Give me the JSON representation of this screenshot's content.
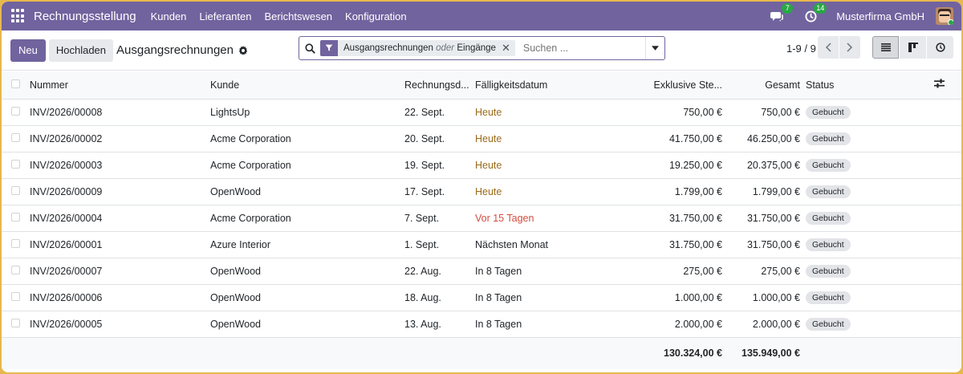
{
  "navbar": {
    "brand": "Rechnungsstellung",
    "menu": [
      "Kunden",
      "Lieferanten",
      "Berichtswesen",
      "Konfiguration"
    ],
    "messages_count": "7",
    "activities_count": "14",
    "company": "Musterfirma GmbH",
    "color": "#71639e"
  },
  "control": {
    "new_label": "Neu",
    "upload_label": "Hochladen",
    "title": "Ausgangsrechnungen",
    "search": {
      "facet_part1": "Ausgangsrechnungen",
      "facet_or": "oder",
      "facet_part2": "Eingänge",
      "placeholder": "Suchen ..."
    },
    "pager": "1-9 / 9"
  },
  "table": {
    "headers": {
      "number": "Nummer",
      "customer": "Kunde",
      "invoice_date": "Rechnungsd...",
      "due_date": "Fälligkeitsdatum",
      "excl_tax": "Exklusive Ste...",
      "total": "Gesamt",
      "status": "Status"
    },
    "rows": [
      {
        "number": "INV/2026/00008",
        "customer": "LightsUp",
        "date": "22. Sept.",
        "due": "Heute",
        "due_state": "today",
        "excl": "750,00 €",
        "total": "750,00 €",
        "status": "Gebucht"
      },
      {
        "number": "INV/2026/00002",
        "customer": "Acme Corporation",
        "date": "20. Sept.",
        "due": "Heute",
        "due_state": "today",
        "excl": "41.750,00 €",
        "total": "46.250,00 €",
        "status": "Gebucht"
      },
      {
        "number": "INV/2026/00003",
        "customer": "Acme Corporation",
        "date": "19. Sept.",
        "due": "Heute",
        "due_state": "today",
        "excl": "19.250,00 €",
        "total": "20.375,00 €",
        "status": "Gebucht"
      },
      {
        "number": "INV/2026/00009",
        "customer": "OpenWood",
        "date": "17. Sept.",
        "due": "Heute",
        "due_state": "today",
        "excl": "1.799,00 €",
        "total": "1.799,00 €",
        "status": "Gebucht"
      },
      {
        "number": "INV/2026/00004",
        "customer": "Acme Corporation",
        "date": "7. Sept.",
        "due": "Vor 15 Tagen",
        "due_state": "late",
        "excl": "31.750,00 €",
        "total": "31.750,00 €",
        "status": "Gebucht"
      },
      {
        "number": "INV/2026/00001",
        "customer": "Azure Interior",
        "date": "1. Sept.",
        "due": "Nächsten Monat",
        "due_state": "normal",
        "excl": "31.750,00 €",
        "total": "31.750,00 €",
        "status": "Gebucht"
      },
      {
        "number": "INV/2026/00007",
        "customer": "OpenWood",
        "date": "22. Aug.",
        "due": "In 8 Tagen",
        "due_state": "normal",
        "excl": "275,00 €",
        "total": "275,00 €",
        "status": "Gebucht"
      },
      {
        "number": "INV/2026/00006",
        "customer": "OpenWood",
        "date": "18. Aug.",
        "due": "In 8 Tagen",
        "due_state": "normal",
        "excl": "1.000,00 €",
        "total": "1.000,00 €",
        "status": "Gebucht"
      },
      {
        "number": "INV/2026/00005",
        "customer": "OpenWood",
        "date": "13. Aug.",
        "due": "In 8 Tagen",
        "due_state": "normal",
        "excl": "2.000,00 €",
        "total": "2.000,00 €",
        "status": "Gebucht"
      }
    ],
    "totals": {
      "excl": "130.324,00 €",
      "total": "135.949,00 €"
    }
  },
  "icons": [
    "apps-icon",
    "chat-icon",
    "clock-icon",
    "gear-icon",
    "search-icon",
    "filter-icon",
    "close-icon",
    "caret-down-icon",
    "chevron-left-icon",
    "chevron-right-icon",
    "list-view-icon",
    "kanban-view-icon",
    "activity-view-icon",
    "optional-columns-icon"
  ]
}
